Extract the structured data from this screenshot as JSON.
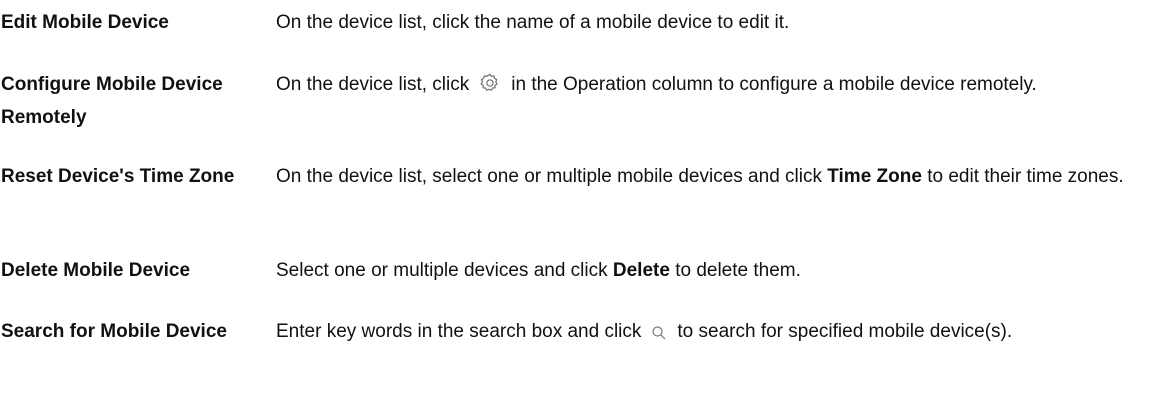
{
  "rows": [
    {
      "term": "Edit Mobile Device",
      "desc": "On the device list, click the name of a mobile device to edit it."
    },
    {
      "term": "Configure Mobile Device Remotely",
      "desc_before": "On the device list, click",
      "desc_icon": "gear-icon",
      "desc_after": "in the Operation column to configure a mobile device remotely."
    },
    {
      "term": "Reset Device's Time Zone",
      "desc_before": "On the device list, select one or multiple mobile devices and click",
      "desc_bold": "Time Zone",
      "desc_after": "to edit their time zones."
    },
    {
      "term": "Delete Mobile Device",
      "desc_before": "Select one or multiple devices and click",
      "desc_bold": "Delete",
      "desc_after": "to delete them."
    },
    {
      "term": "Search for Mobile Device",
      "desc_before": "Enter key words in the search box and click",
      "desc_icon": "search-icon",
      "desc_after": "to search for specified mobile device(s)."
    }
  ]
}
